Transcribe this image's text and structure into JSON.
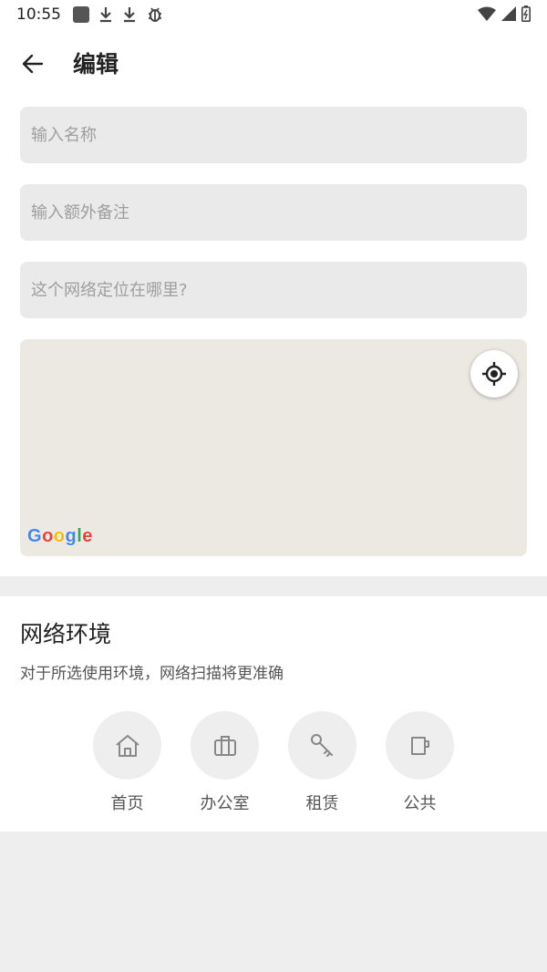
{
  "status_bar": {
    "time": "10:55",
    "left_icons": [
      "notification-square-icon",
      "download-icon",
      "download-icon",
      "debug-bug-icon"
    ],
    "right_icons": [
      "wifi-icon",
      "signal-icon",
      "battery-icon"
    ]
  },
  "app_bar": {
    "back_icon": "arrow-left-icon",
    "title": "编辑"
  },
  "form": {
    "name_placeholder": "输入名称",
    "name_value": "",
    "note_placeholder": "输入额外备注",
    "note_value": "",
    "location_placeholder": "这个网络定位在哪里?",
    "location_value": ""
  },
  "map": {
    "locate_icon": "my-location-icon",
    "logo_text": "Google",
    "logo_colors": [
      "#4285F4",
      "#EA4335",
      "#FBBC05",
      "#4285F4",
      "#34A853",
      "#EA4335"
    ]
  },
  "network_env": {
    "title": "网络环境",
    "description": "对于所选使用环境，网络扫描将更准确",
    "options": [
      {
        "label": "首页",
        "icon": "home-icon"
      },
      {
        "label": "办公室",
        "icon": "briefcase-icon"
      },
      {
        "label": "租赁",
        "icon": "key-icon"
      },
      {
        "label": "公共",
        "icon": "coffee-cup-icon"
      }
    ]
  },
  "colors": {
    "background": "#eeeeee",
    "field_background": "#eaeaea",
    "map_background": "#ebe9e1",
    "icon_gray": "#888888"
  }
}
